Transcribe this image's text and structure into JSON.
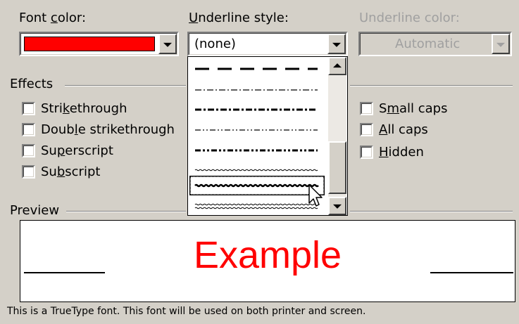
{
  "font_color": {
    "label_pre": "Font ",
    "label_access": "c",
    "label_post": "olor:",
    "value_color": "#ff0000"
  },
  "underline_style": {
    "label_access": "U",
    "label_post": "nderline style:",
    "value": "(none)",
    "options": [
      "long-dash",
      "dash-dot",
      "dash-dot-heavy",
      "dash-dot-dot",
      "dash-dot-dot-heavy",
      "wave",
      "wave-heavy",
      "wave-double"
    ],
    "selected_option": "wave-heavy"
  },
  "underline_color": {
    "label": "Underline color:",
    "value": "Automatic"
  },
  "effects": {
    "title": "Effects",
    "strikethrough": {
      "pre": "Stri",
      "access": "k",
      "post": "ethrough"
    },
    "double_strikethrough": {
      "pre": "Doub",
      "access": "l",
      "post": "e strikethrough"
    },
    "superscript": {
      "pre": "Su",
      "access": "p",
      "post": "erscript"
    },
    "subscript": {
      "pre": "Su",
      "access": "b",
      "post": "script"
    },
    "small_caps": {
      "pre": "S",
      "access": "m",
      "post": "all caps"
    },
    "all_caps": {
      "pre": "",
      "access": "A",
      "post": "ll caps"
    },
    "hidden": {
      "pre": "",
      "access": "H",
      "post": "idden"
    }
  },
  "preview": {
    "title": "Preview",
    "sample_text": "Example",
    "sample_color": "#ff0000"
  },
  "footer_note": "This is a TrueType font. This font will be used on both printer and screen."
}
